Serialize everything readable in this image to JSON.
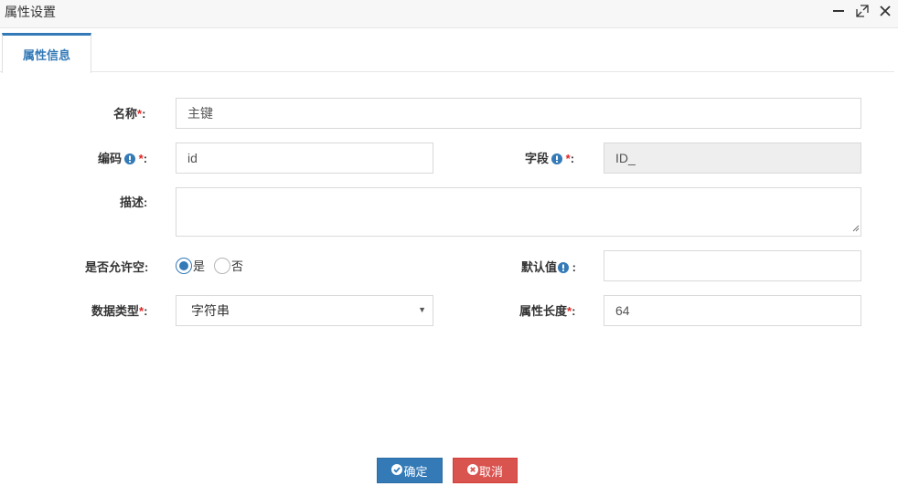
{
  "window": {
    "title": "属性设置",
    "controls": [
      "minimize-icon",
      "maximize-icon",
      "close-icon"
    ]
  },
  "tabs": [
    {
      "label": "属性信息",
      "active": true
    }
  ],
  "form": {
    "name": {
      "label": "名称",
      "required_mark": "*",
      "suffix": ":",
      "value": "主键"
    },
    "code": {
      "label": "编码",
      "required_mark": "*",
      "suffix": ":",
      "value": "id",
      "icon": "info-icon"
    },
    "column": {
      "label": "字段",
      "required_mark": "*",
      "suffix": ":",
      "value": "ID_",
      "icon": "info-icon",
      "readonly": true
    },
    "description": {
      "label": "描述:",
      "value": ""
    },
    "nullable": {
      "label": "是否允许空:",
      "options": [
        {
          "label": "是",
          "checked": true
        },
        {
          "label": "否",
          "checked": false
        }
      ]
    },
    "default_value": {
      "label": "默认值",
      "suffix": " :",
      "value": "",
      "icon": "info-icon"
    },
    "data_type": {
      "label": "数据类型",
      "required_mark": "*",
      "suffix": ":",
      "value": "字符串"
    },
    "length": {
      "label": "属性长度",
      "required_mark": "*",
      "suffix": ":",
      "value": "64"
    }
  },
  "buttons": {
    "ok": {
      "label": "确定",
      "icon": "check-circle-icon"
    },
    "cancel": {
      "label": "取消",
      "icon": "times-circle-icon"
    }
  },
  "colors": {
    "primary": "#337ab7",
    "danger": "#d9534f",
    "required": "#e02222"
  }
}
